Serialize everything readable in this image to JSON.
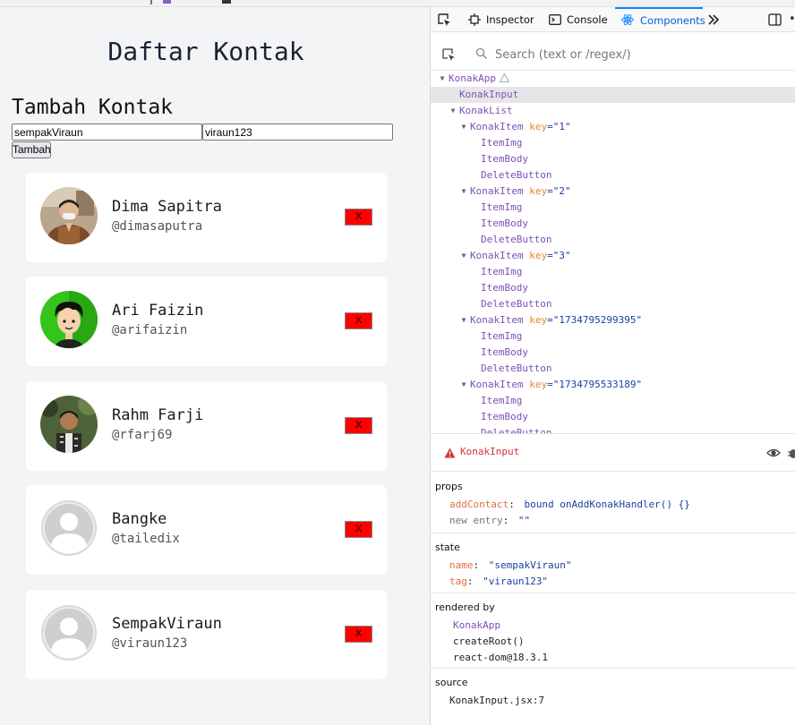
{
  "app": {
    "title": "Daftar Kontak",
    "form_title": "Tambah Kontak",
    "name_value": "sempakViraun",
    "tag_value": "viraun123",
    "add_label": "Tambah",
    "delete_label": "X",
    "contacts": [
      {
        "name": "Dima Sapitra",
        "tag": "@dimasaputra",
        "avatar": "photo"
      },
      {
        "name": "Ari Faizin",
        "tag": "@arifaizin",
        "avatar": "cartoon"
      },
      {
        "name": "Rahm Farji",
        "tag": "@rfarj69",
        "avatar": "photo"
      },
      {
        "name": "Bangke",
        "tag": "@tailedix",
        "avatar": "default-user"
      },
      {
        "name": "SempakViraun",
        "tag": "@viraun123",
        "avatar": "default-user"
      }
    ]
  },
  "devtools": {
    "tabs": [
      {
        "label": "Inspector",
        "icon": "inspector-icon"
      },
      {
        "label": "Console",
        "icon": "console-icon"
      },
      {
        "label": "Components",
        "icon": "react-icon"
      }
    ],
    "search_placeholder": "Search (text or /regex/)",
    "tree": [
      {
        "depth": 0,
        "arrow": true,
        "name": "KonakApp",
        "warn": true
      },
      {
        "depth": 1,
        "arrow": false,
        "name": "KonakInput",
        "selected": true
      },
      {
        "depth": 1,
        "arrow": true,
        "name": "KonakList"
      },
      {
        "depth": 2,
        "arrow": true,
        "name": "KonakItem",
        "key": "\"1\""
      },
      {
        "depth": 3,
        "arrow": false,
        "name": "ItemImg"
      },
      {
        "depth": 3,
        "arrow": false,
        "name": "ItemBody"
      },
      {
        "depth": 3,
        "arrow": false,
        "name": "DeleteButton"
      },
      {
        "depth": 2,
        "arrow": true,
        "name": "KonakItem",
        "key": "\"2\""
      },
      {
        "depth": 3,
        "arrow": false,
        "name": "ItemImg"
      },
      {
        "depth": 3,
        "arrow": false,
        "name": "ItemBody"
      },
      {
        "depth": 3,
        "arrow": false,
        "name": "DeleteButton"
      },
      {
        "depth": 2,
        "arrow": true,
        "name": "KonakItem",
        "key": "\"3\""
      },
      {
        "depth": 3,
        "arrow": false,
        "name": "ItemImg"
      },
      {
        "depth": 3,
        "arrow": false,
        "name": "ItemBody"
      },
      {
        "depth": 3,
        "arrow": false,
        "name": "DeleteButton"
      },
      {
        "depth": 2,
        "arrow": true,
        "name": "KonakItem",
        "key": "\"1734795299395\""
      },
      {
        "depth": 3,
        "arrow": false,
        "name": "ItemImg"
      },
      {
        "depth": 3,
        "arrow": false,
        "name": "ItemBody"
      },
      {
        "depth": 3,
        "arrow": false,
        "name": "DeleteButton"
      },
      {
        "depth": 2,
        "arrow": true,
        "name": "KonakItem",
        "key": "\"1734795533189\""
      },
      {
        "depth": 3,
        "arrow": false,
        "name": "ItemImg"
      },
      {
        "depth": 3,
        "arrow": false,
        "name": "ItemBody"
      },
      {
        "depth": 3,
        "arrow": false,
        "name": "DeleteButton"
      }
    ],
    "key_label": "key",
    "selected": {
      "name": "KonakInput",
      "props_title": "props",
      "props": [
        {
          "key": "addContact",
          "value": "bound onAddKonakHandler() {}"
        },
        {
          "key": "new entry",
          "value": "\"\""
        }
      ],
      "state_title": "state",
      "state": [
        {
          "key": "name",
          "value": "\"sempakViraun\""
        },
        {
          "key": "tag",
          "value": "\"viraun123\""
        }
      ],
      "rendered_by_title": "rendered by",
      "rendered_by": [
        "KonakApp",
        "createRoot()",
        "react-dom@18.3.1"
      ],
      "source_title": "source",
      "source": "KonakInput.jsx:7"
    }
  },
  "colors": {
    "app_bg": "#f3f4f6",
    "delete_btn": "#ff0000",
    "component_name": "#7b51b5",
    "attr_key": "#e8842d",
    "attr_value": "#1b3f9e",
    "active_tab": "#0060df",
    "warning": "#d0363a"
  }
}
